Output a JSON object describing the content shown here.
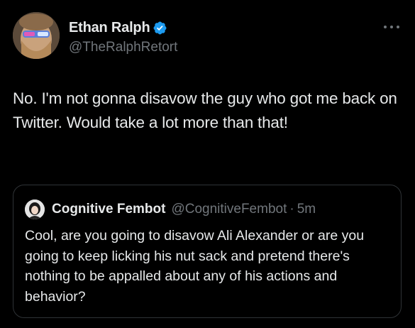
{
  "author": {
    "display_name": "Ethan Ralph",
    "handle": "@TheRalphRetort",
    "verified": true
  },
  "tweet": {
    "text": "No. I'm not gonna disavow the guy who got me back on Twitter. Would take a lot more than that!"
  },
  "quoted_tweet": {
    "display_name": "Cognitive Fembot",
    "handle": "@CognitiveFembot",
    "separator": "·",
    "time": "5m",
    "text": "Cool, are you going to disavow Ali Alexander or are you going to keep licking his nut sack and pretend there's nothing to be appalled about any of his actions and behavior?"
  },
  "icons": {
    "verified": "verified-badge-icon",
    "more": "more-options-icon"
  },
  "colors": {
    "background": "#000000",
    "text_primary": "#e7e9ea",
    "text_secondary": "#71767b",
    "verified": "#1d9bf0",
    "border": "#2f3336"
  }
}
